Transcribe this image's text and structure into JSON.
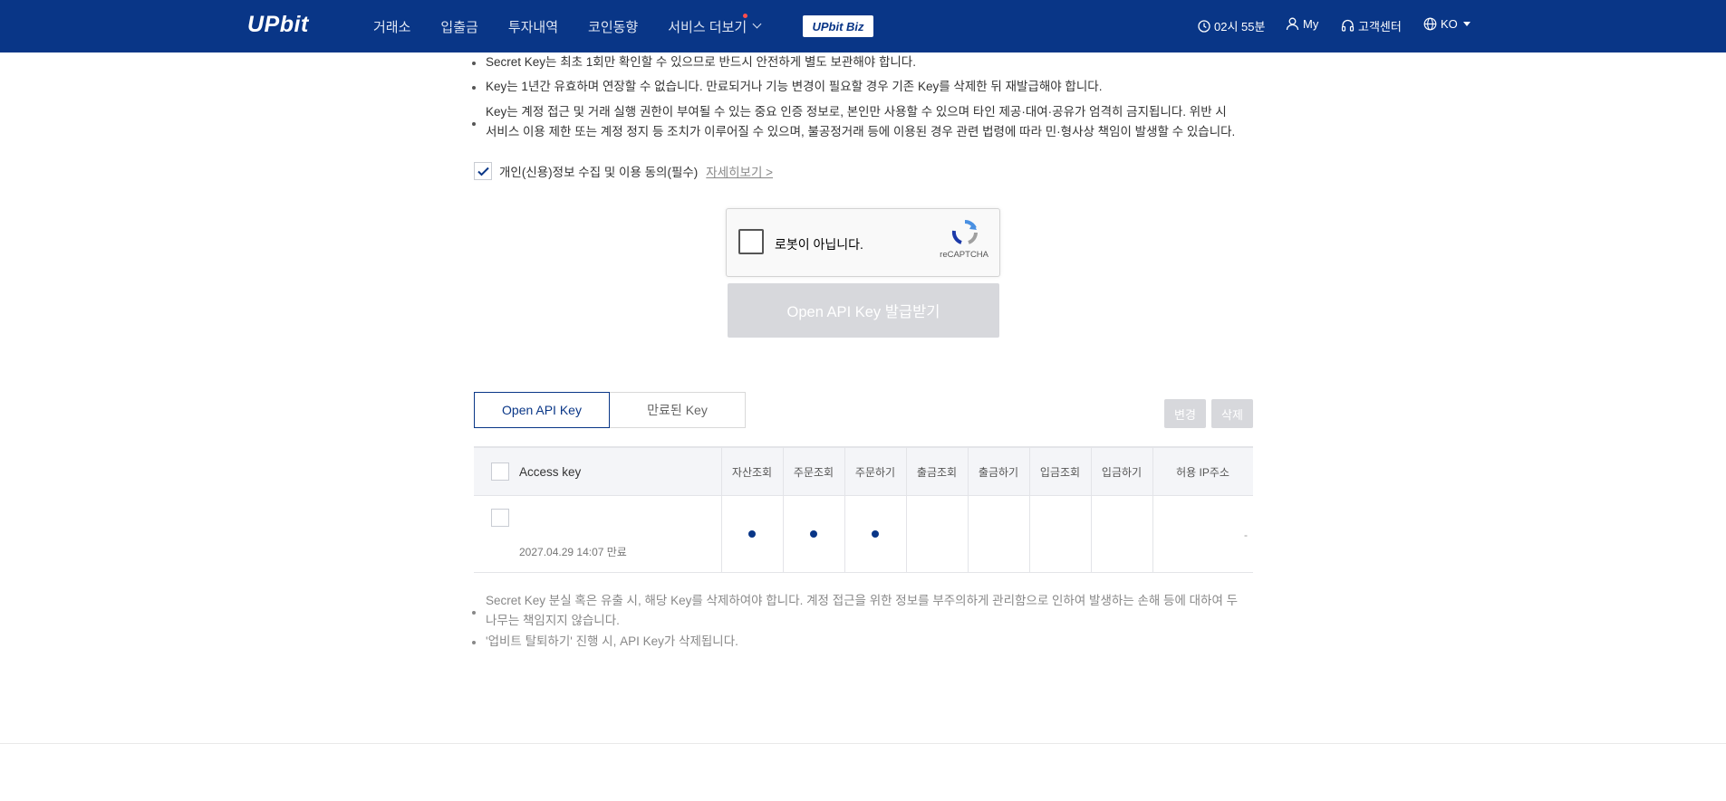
{
  "header": {
    "logo": "UPbit",
    "nav": [
      {
        "label": "거래소"
      },
      {
        "label": "입출금"
      },
      {
        "label": "투자내역"
      },
      {
        "label": "코인동향"
      },
      {
        "label": "서비스 더보기"
      }
    ],
    "biz_label": "UPbit Biz",
    "time": "02시 55분",
    "my": "My",
    "support": "고객센터",
    "lang": "KO"
  },
  "notices_top": [
    "Secret Key는 최초 1회만 확인할 수 있으므로 반드시 안전하게 별도 보관해야 합니다.",
    "Key는 1년간 유효하며 연장할 수 없습니다. 만료되거나 기능 변경이 필요할 경우 기존 Key를 삭제한 뒤 재발급해야 합니다.",
    "Key는 계정 접근 및 거래 실행 권한이 부여될 수 있는 중요 인증 정보로, 본인만 사용할 수 있으며 타인 제공·대여·공유가 엄격히 금지됩니다. 위반 시",
    "서비스 이용 제한 또는 계정 정지 등 조치가 이루어질 수 있으며, 불공정거래 등에 이용된 경우 관련 법령에 따라 민·형사상 책임이 발생할 수 있습니다."
  ],
  "agree": {
    "label": "개인(신용)정보 수집 및 이용 동의(필수)",
    "link": "자세히보기 >",
    "checked": true
  },
  "captcha": {
    "label": "로봇이 아닙니다.",
    "brand": "reCAPTCHA"
  },
  "issue_button": "Open API Key 발급받기",
  "tabs": {
    "active": "Open API Key",
    "expired": "만료된 Key"
  },
  "actions": {
    "change": "변경",
    "delete": "삭제"
  },
  "table": {
    "columns": {
      "access_key": "Access key",
      "asset_view": "자산조회",
      "order_view": "주문조회",
      "order": "주문하기",
      "withdraw_view": "출금조회",
      "withdraw": "출금하기",
      "deposit_view": "입금조회",
      "deposit": "입금하기",
      "ip": "허용 IP주소"
    },
    "rows": [
      {
        "expire": "2027.04.29 14:07 만료",
        "ip": "-",
        "asset_view": true,
        "order_view": true,
        "order": true,
        "withdraw_view": false,
        "withdraw": false,
        "deposit_view": false,
        "deposit": false
      }
    ]
  },
  "notices_bottom": [
    "Secret Key 분실 혹은 유출 시, 해당 Key를 삭제하여야 합니다. 계정 접근을 위한 정보를 부주의하게 관리함으로 인하여 발생하는 손해 등에 대하여 두",
    "나무는 책임지지 않습니다.",
    "'업비트 탈퇴하기' 진행 시, API Key가 삭제됩니다."
  ],
  "colors": {
    "brand": "#093687",
    "disabled": "#d7d8dc"
  }
}
